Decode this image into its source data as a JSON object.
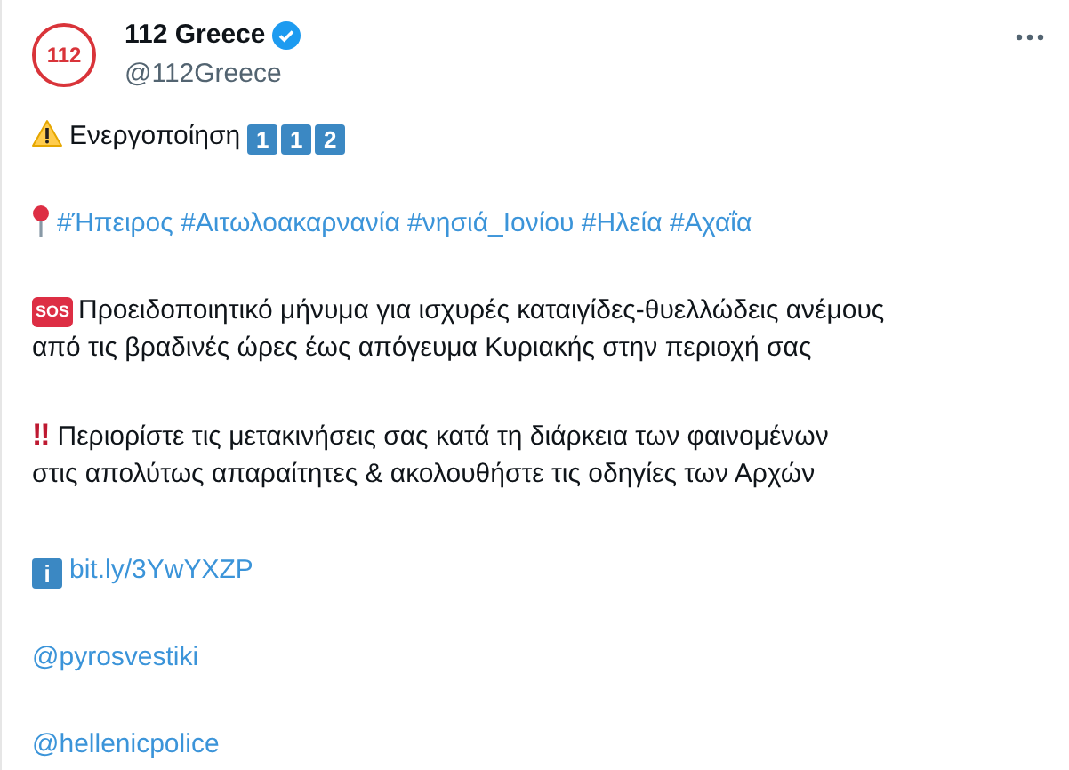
{
  "author": {
    "avatar_text": "112",
    "name": "112 Greece",
    "verified": true,
    "handle": "@112Greece"
  },
  "paragraphs": [
    {
      "kind": "activation",
      "text": "Ενεργοποίηση",
      "keycaps": [
        "1",
        "1",
        "2"
      ]
    },
    {
      "kind": "hashtags",
      "tags": [
        "#Ήπειρος",
        "#Αιτωλοακαρνανία",
        "#νησιά_Ιονίου",
        "#Ηλεία",
        "#Αχαΐα"
      ]
    },
    {
      "kind": "sos",
      "badge": "SOS",
      "lines": [
        "Προειδοποιητικό μήνυμα για ισχυρές καταιγίδες-θυελλώδεις ανέμους",
        "από τις βραδινές ώρες έως απόγευμα Κυριακής στην περιοχή σας"
      ]
    },
    {
      "kind": "alert",
      "mark": "‼",
      "lines": [
        "Περιορίστε τις μετακινήσεις σας κατά τη διάρκεια των φαινομένων",
        "στις απολύτως απαραίτητες & ακολουθήστε τις οδηγίες των Αρχών"
      ]
    },
    {
      "kind": "info",
      "badge": "i",
      "link": "bit.ly/3YwYXZP"
    },
    {
      "kind": "mention",
      "link": "@pyrosvestiki"
    },
    {
      "kind": "mention",
      "link": "@hellenicpolice"
    }
  ]
}
